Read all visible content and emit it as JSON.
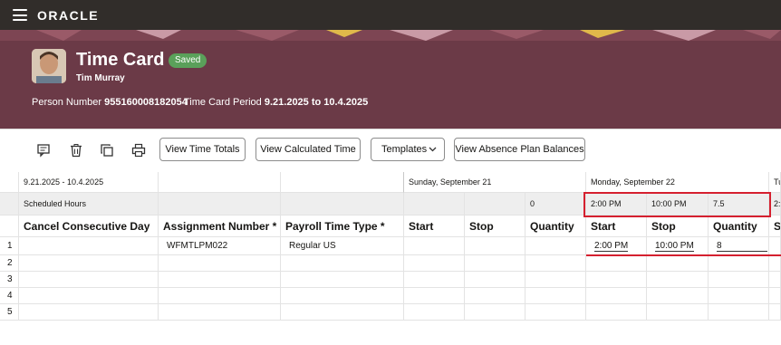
{
  "app": {
    "brand": "ORACLE"
  },
  "header": {
    "title": "Time Card",
    "status": "Saved",
    "person_name": "Tim Murray",
    "person_number_label": "Person Number",
    "person_number": "955160008182054",
    "period_label": "Time Card Period",
    "period": "9.21.2025 to 10.4.2025"
  },
  "toolbar": {
    "icons": [
      "comment-icon",
      "delete-icon",
      "copy-icon",
      "print-icon"
    ],
    "buttons": {
      "view_time_totals": "View Time Totals",
      "view_calculated_time": "View Calculated Time",
      "templates": "Templates",
      "view_absence_balances": "View Absence Plan Balances"
    }
  },
  "grid": {
    "period_range": "9.21.2025 - 10.4.2025",
    "day1": "Sunday, September 21",
    "day2": "Monday, September 22",
    "day3": "Tu",
    "scheduled_label": "Scheduled Hours",
    "sched_day1_qty": "0",
    "sched_day2_start": "2:00 PM",
    "sched_day2_stop": "10:00 PM",
    "sched_day2_qty": "7.5",
    "sched_day3_partial": "2:",
    "columns": {
      "cancel": "Cancel Consecutive Day",
      "assignment": "Assignment Number *",
      "payroll": "Payroll Time Type *",
      "start1": "Start",
      "stop1": "Stop",
      "qty1": "Quantity",
      "start2": "Start",
      "stop2": "Stop",
      "qty2": "Quantity",
      "partial": "S"
    },
    "rows": [
      {
        "num": "1",
        "assignment": "WFMTLPM022",
        "payroll": "Regular US",
        "start2": "2:00 PM",
        "stop2": "10:00 PM",
        "qty2": "8"
      },
      {
        "num": "2"
      },
      {
        "num": "3"
      },
      {
        "num": "4"
      },
      {
        "num": "5"
      }
    ]
  },
  "colors": {
    "banner": "#6b3a47",
    "topbar": "#312d2a",
    "saved_badge": "#5aa05a",
    "highlight": "#d5202f"
  }
}
